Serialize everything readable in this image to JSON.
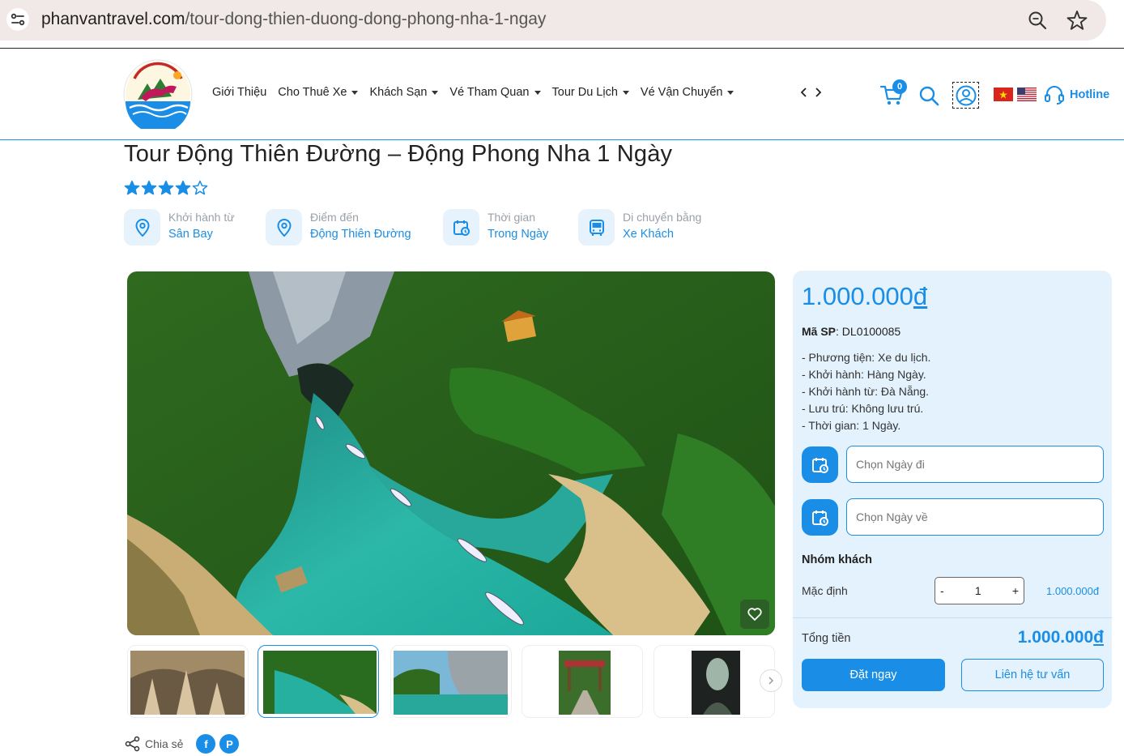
{
  "browser": {
    "url_host": "phanvantravel.com",
    "url_path": "/tour-dong-thien-duong-dong-phong-nha-1-ngay"
  },
  "header": {
    "nav": [
      {
        "label": "Giới Thiệu",
        "has_dropdown": false
      },
      {
        "label": "Cho Thuê Xe",
        "has_dropdown": true
      },
      {
        "label": "Khách Sạn",
        "has_dropdown": true
      },
      {
        "label": "Vé Tham Quan",
        "has_dropdown": true
      },
      {
        "label": "Tour Du Lịch",
        "has_dropdown": true
      },
      {
        "label": "Vé Vận Chuyển",
        "has_dropdown": true
      }
    ],
    "nav_arrows": "‹ ›",
    "cart_count": "0",
    "hotline_label": "Hotline"
  },
  "tour": {
    "title": "Tour Động Thiên Đường – Động Phong Nha 1 Ngày",
    "rating": 4,
    "rating_max": 5,
    "facts": [
      {
        "label": "Khởi hành từ",
        "value": "Sân Bay",
        "icon": "location-pin-icon"
      },
      {
        "label": "Điểm đến",
        "value": "Động Thiên Đường",
        "icon": "location-pin-icon"
      },
      {
        "label": "Thời gian",
        "value": "Trong Ngày",
        "icon": "calendar-clock-icon"
      },
      {
        "label": "Di chuyển bằng",
        "value": "Xe Khách",
        "icon": "bus-icon"
      }
    ],
    "share_label": "Chia sẻ"
  },
  "booking": {
    "price_main": "1.000.000",
    "price_currency": "đ",
    "sku_label": "Mã SP",
    "sku_value": ": DL0100085",
    "details": [
      "- Phương tiện: Xe du lịch.",
      "- Khởi hành: Hàng Ngày.",
      "- Khởi hành từ: Đà Nẵng.",
      "- Lưu trú: Không lưu trú.",
      "- Thời gian: 1 Ngày."
    ],
    "depart_placeholder": "Chọn Ngày đi",
    "return_placeholder": "Chọn Ngày về",
    "group_title": "Nhóm khách",
    "group_label": "Mặc định",
    "qty_minus": "-",
    "qty_value": "1",
    "qty_plus": "+",
    "unit_price": "1.000.000đ",
    "total_label": "Tổng tiền",
    "total_main": "1.000.000",
    "total_currency": "đ",
    "book_label": "Đặt ngay",
    "contact_label": "Liên hệ tư vấn"
  },
  "colors": {
    "accent": "#1a8ee6",
    "panel_bg": "#e3f2fd",
    "star": "#1a8ee6"
  }
}
